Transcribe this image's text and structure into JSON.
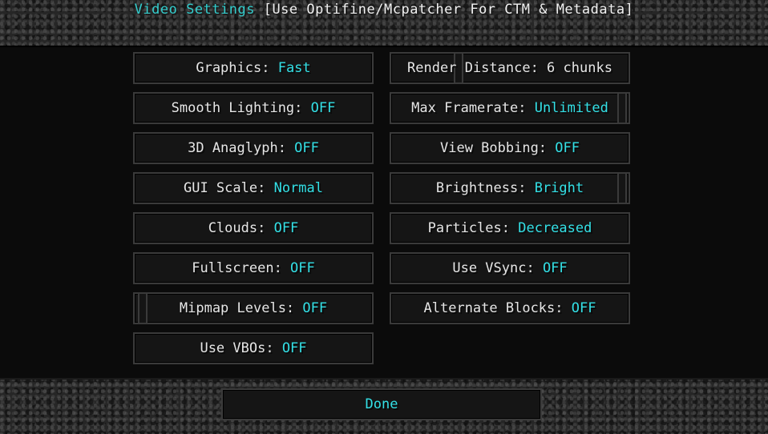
{
  "title": {
    "accent_text": "Video Settings",
    "rest_text": " [Use Optifine/Mcpatcher For CTM & Metadata]"
  },
  "options": {
    "graphics": {
      "label": "Graphics: ",
      "value": "Fast"
    },
    "render_distance": {
      "label": "Render Distance: ",
      "value": "6 chunks"
    },
    "smooth_lighting": {
      "label": "Smooth Lighting: ",
      "value": "OFF"
    },
    "max_framerate": {
      "label": "Max Framerate: ",
      "value": "Unlimited"
    },
    "anaglyph": {
      "label": "3D Anaglyph: ",
      "value": "OFF"
    },
    "view_bobbing": {
      "label": "View Bobbing: ",
      "value": "OFF"
    },
    "gui_scale": {
      "label": "GUI Scale: ",
      "value": "Normal"
    },
    "brightness": {
      "label": "Brightness: ",
      "value": "Bright"
    },
    "clouds": {
      "label": "Clouds: ",
      "value": "OFF"
    },
    "particles": {
      "label": "Particles: ",
      "value": "Decreased"
    },
    "fullscreen": {
      "label": "Fullscreen: ",
      "value": "OFF"
    },
    "vsync": {
      "label": "Use VSync: ",
      "value": "OFF"
    },
    "mipmap": {
      "label": "Mipmap Levels: ",
      "value": "OFF"
    },
    "alternate_blocks": {
      "label": "Alternate Blocks: ",
      "value": "OFF"
    },
    "vbos": {
      "label": "Use VBOs: ",
      "value": "OFF"
    }
  },
  "done_label": "Done",
  "colors": {
    "accent": "#33e0e6",
    "text": "#e6e6e6"
  }
}
